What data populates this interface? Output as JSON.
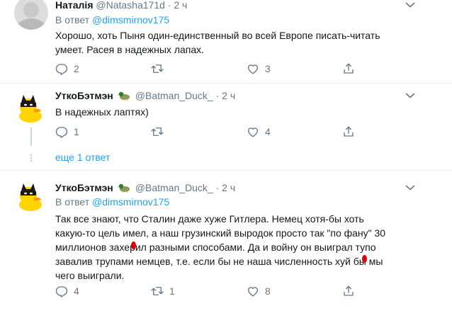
{
  "tweets": [
    {
      "name": "Наталія",
      "handle": "@Natasha171d",
      "dot": "·",
      "time": "2 ч",
      "reply_prefix": "В ответ",
      "reply_to": "@dimsmirnov175",
      "text_lines": [
        "Хорошо, хоть Пыня один-единственный во всей Европе писать-читать",
        "умеет. Расея в надежных лапах."
      ],
      "replies": "2",
      "retweets": "",
      "likes": "3"
    },
    {
      "name": "УткоБэтмэн",
      "handle": "@Batman_Duck_",
      "dot": "·",
      "time": "2 ч",
      "text_lines": [
        "В надежных лаптях)"
      ],
      "replies": "1",
      "retweets": "",
      "likes": "4"
    },
    {
      "name": "УткоБэтмэн",
      "handle": "@Batman_Duck_",
      "dot": "·",
      "time": "2 ч",
      "reply_prefix": "В ответ",
      "reply_to": "@dimsmirnov175",
      "text_lines": [
        "Так все знают, что Сталин даже хуже Гитлера. Немец хотя-бы хоть",
        "какую-то цель имел, а наш грузинский выродок просто так \"по фану\" 30",
        "миллионов захерил разными способами. Да и войну он выиграл тупо",
        "завалив трупами немцев, т.е. если бы не наша численность хуй бы мы",
        "чего выиграли."
      ],
      "replies": "4",
      "retweets": "1",
      "likes": "8"
    }
  ],
  "show_more": "еще 1 ответ",
  "icons": {
    "reply": "speech-bubble-icon",
    "retweet": "retweet-icon",
    "like": "heart-icon",
    "share": "share-icon",
    "caret": "chevron-down-icon",
    "badge": "duck-emoji-icon"
  },
  "colors": {
    "link": "#1da1f2",
    "muted": "#657786",
    "text": "#14171a",
    "separator": "#e6ecf0",
    "avatar_duck": "#ffd400"
  }
}
